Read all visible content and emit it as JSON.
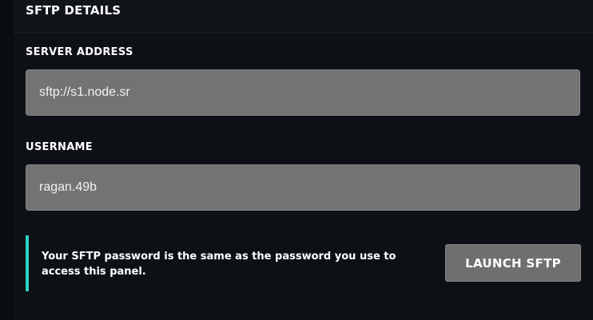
{
  "card": {
    "title": "SFTP DETAILS"
  },
  "fields": {
    "server_address": {
      "label": "SERVER ADDRESS",
      "value": "sftp://s1.node.sr"
    },
    "username": {
      "label": "USERNAME",
      "value": "ragan.49b"
    }
  },
  "notice": {
    "text": "Your SFTP password is the same as the password you use to access this panel.",
    "accent_color": "#2ad4c6"
  },
  "actions": {
    "launch_label": "LAUNCH SFTP"
  }
}
